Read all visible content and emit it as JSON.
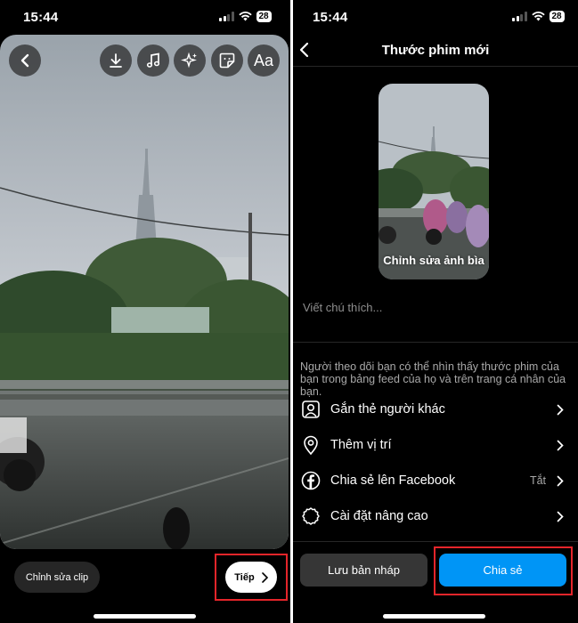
{
  "left": {
    "status": {
      "time": "15:44",
      "battery": "28"
    },
    "toolbar": {
      "back": "chevron-left-icon",
      "tools": [
        "download-icon",
        "music-icon",
        "effects-icon",
        "sticker-icon",
        "text-icon"
      ],
      "text_tool_label": "Aa"
    },
    "edit_clip_label": "Chỉnh sửa clip",
    "next_label": "Tiếp"
  },
  "right": {
    "status": {
      "time": "15:44",
      "battery": "28"
    },
    "title": "Thước phim mới",
    "cover_label": "Chỉnh sửa ảnh bìa",
    "caption_placeholder": "Viết chú thích...",
    "notice": "Người theo dõi bạn có thể nhìn thấy thước phim của bạn trong bảng feed của họ và trên trang cá nhân của bạn.",
    "options": [
      {
        "label": "Gắn thẻ người khác",
        "icon": "tag-person-icon",
        "value": ""
      },
      {
        "label": "Thêm vị trí",
        "icon": "location-pin-icon",
        "value": ""
      },
      {
        "label": "Chia sẻ lên Facebook",
        "icon": "facebook-icon",
        "value": "Tắt"
      },
      {
        "label": "Cài đặt nâng cao",
        "icon": "gear-icon",
        "value": ""
      }
    ],
    "save_draft_label": "Lưu bản nháp",
    "share_label": "Chia sẻ"
  },
  "colors": {
    "accent": "#0095f6",
    "highlight": "#e5252a",
    "background": "#000000"
  }
}
